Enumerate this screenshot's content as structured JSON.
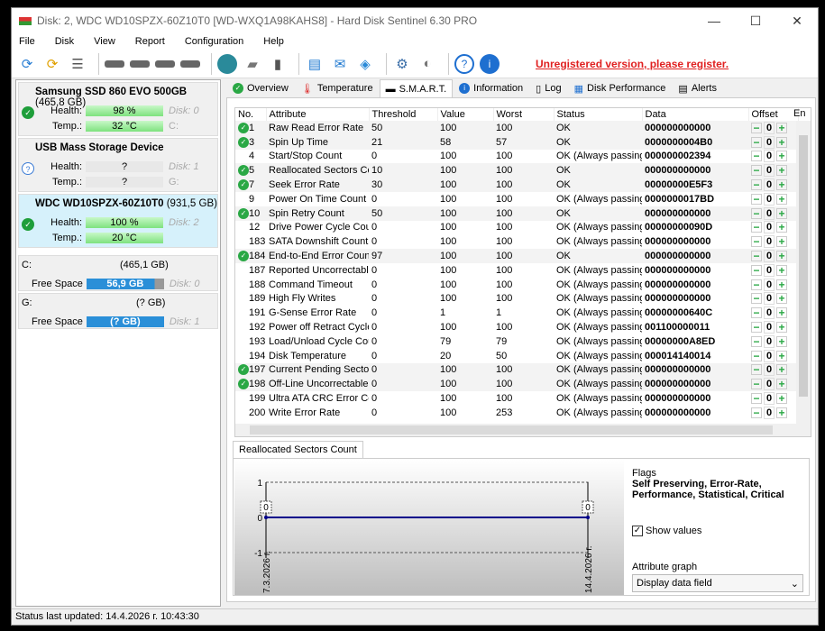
{
  "window": {
    "title": "Disk: 2, WDC WD10SPZX-60Z10T0 [WD-WXQ1A98KAHS8]  -  Hard Disk Sentinel 6.30 PRO",
    "minimize": "—",
    "maximize": "☐",
    "close": "✕"
  },
  "menu": [
    "File",
    "Disk",
    "View",
    "Report",
    "Configuration",
    "Help"
  ],
  "toolbar": {
    "unregistered": "Unregistered version, please register."
  },
  "disks": [
    {
      "name": "Samsung SSD 860 EVO 500GB",
      "size": "(465,8 GB)",
      "health_label": "Health:",
      "health": "98 %",
      "temp_label": "Temp.:",
      "temp": "32 °C",
      "disk": "Disk: 0",
      "drive": "C:",
      "icon": "check"
    },
    {
      "name": "USB Mass Storage Device",
      "size": "",
      "health_label": "Health:",
      "health": "?",
      "temp_label": "Temp.:",
      "temp": "?",
      "disk": "Disk: 1",
      "drive": "G:",
      "icon": "question"
    },
    {
      "name": "WDC WD10SPZX-60Z10T0",
      "size": "(931,5 GB)",
      "health_label": "Health:",
      "health": "100 %",
      "temp_label": "Temp.:",
      "temp": "20 °C",
      "disk": "Disk: 2",
      "drive": "",
      "icon": "check"
    }
  ],
  "volumes": [
    {
      "letter": "C:",
      "size": "(465,1 GB)",
      "label": "Free Space",
      "free": "56,9 GB",
      "disk": "Disk: 0"
    },
    {
      "letter": "G:",
      "size": "(? GB)",
      "label": "Free Space",
      "free": "(? GB)",
      "disk": "Disk: 1"
    }
  ],
  "tabs": [
    "Overview",
    "Temperature",
    "S.M.A.R.T.",
    "Information",
    "Log",
    "Disk Performance",
    "Alerts"
  ],
  "smart": {
    "columns": [
      "No.",
      "Attribute",
      "Threshold",
      "Value",
      "Worst",
      "Status",
      "Data",
      "Offset",
      "En"
    ],
    "rows": [
      [
        "1",
        "Raw Read Error Rate",
        "50",
        "100",
        "100",
        "OK",
        "000000000000",
        "0",
        true
      ],
      [
        "3",
        "Spin Up Time",
        "21",
        "58",
        "57",
        "OK",
        "0000000004B0",
        "0",
        true
      ],
      [
        "4",
        "Start/Stop Count",
        "0",
        "100",
        "100",
        "OK (Always passing)",
        "000000002394",
        "0",
        false
      ],
      [
        "5",
        "Reallocated Sectors Co...",
        "10",
        "100",
        "100",
        "OK",
        "000000000000",
        "0",
        true
      ],
      [
        "7",
        "Seek Error Rate",
        "30",
        "100",
        "100",
        "OK",
        "00000000E5F3",
        "0",
        true
      ],
      [
        "9",
        "Power On Time Count",
        "0",
        "100",
        "100",
        "OK (Always passing)",
        "0000000017BD",
        "0",
        false
      ],
      [
        "10",
        "Spin Retry Count",
        "50",
        "100",
        "100",
        "OK",
        "000000000000",
        "0",
        true
      ],
      [
        "12",
        "Drive Power Cycle Count",
        "0",
        "100",
        "100",
        "OK (Always passing)",
        "00000000090D",
        "0",
        false
      ],
      [
        "183",
        "SATA Downshift Count",
        "0",
        "100",
        "100",
        "OK (Always passing)",
        "000000000000",
        "0",
        false
      ],
      [
        "184",
        "End-to-End Error Count",
        "97",
        "100",
        "100",
        "OK",
        "000000000000",
        "0",
        true
      ],
      [
        "187",
        "Reported Uncorrectabl...",
        "0",
        "100",
        "100",
        "OK (Always passing)",
        "000000000000",
        "0",
        false
      ],
      [
        "188",
        "Command Timeout",
        "0",
        "100",
        "100",
        "OK (Always passing)",
        "000000000000",
        "0",
        false
      ],
      [
        "189",
        "High Fly Writes",
        "0",
        "100",
        "100",
        "OK (Always passing)",
        "000000000000",
        "0",
        false
      ],
      [
        "191",
        "G-Sense Error Rate",
        "0",
        "1",
        "1",
        "OK (Always passing)",
        "00000000640C",
        "0",
        false
      ],
      [
        "192",
        "Power off Retract Cycle ...",
        "0",
        "100",
        "100",
        "OK (Always passing)",
        "001100000011",
        "0",
        false
      ],
      [
        "193",
        "Load/Unload Cycle Cou...",
        "0",
        "79",
        "79",
        "OK (Always passing)",
        "00000000A8ED",
        "0",
        false
      ],
      [
        "194",
        "Disk Temperature",
        "0",
        "20",
        "50",
        "OK (Always passing)",
        "000014140014",
        "0",
        false
      ],
      [
        "197",
        "Current Pending Sector...",
        "0",
        "100",
        "100",
        "OK (Always passing)",
        "000000000000",
        "0",
        true
      ],
      [
        "198",
        "Off-Line Uncorrectable ...",
        "0",
        "100",
        "100",
        "OK (Always passing)",
        "000000000000",
        "0",
        true
      ],
      [
        "199",
        "Ultra ATA CRC Error Co...",
        "0",
        "100",
        "100",
        "OK (Always passing)",
        "000000000000",
        "0",
        false
      ],
      [
        "200",
        "Write Error Rate",
        "0",
        "100",
        "253",
        "OK (Always passing)",
        "000000000000",
        "0",
        false
      ]
    ]
  },
  "graph": {
    "tab": "Reallocated Sectors Count",
    "flags_label": "Flags",
    "flags": "Self Preserving, Error-Rate, Performance, Statistical, Critical",
    "show_values": "Show values",
    "show_values_checked": true,
    "attr_graph_label": "Attribute graph",
    "attr_graph_value": "Display data field"
  },
  "chart_data": {
    "type": "line",
    "x": [
      "7.3.2026 г.",
      "14.4.2026 г."
    ],
    "values": [
      0,
      0
    ],
    "ylim": [
      -1,
      1
    ],
    "yticks": [
      "1",
      "0",
      "-1"
    ],
    "point_labels": [
      "0",
      "0"
    ],
    "color": "#00008b"
  },
  "status": "Status last updated: 14.4.2026 г. 10:43:30"
}
